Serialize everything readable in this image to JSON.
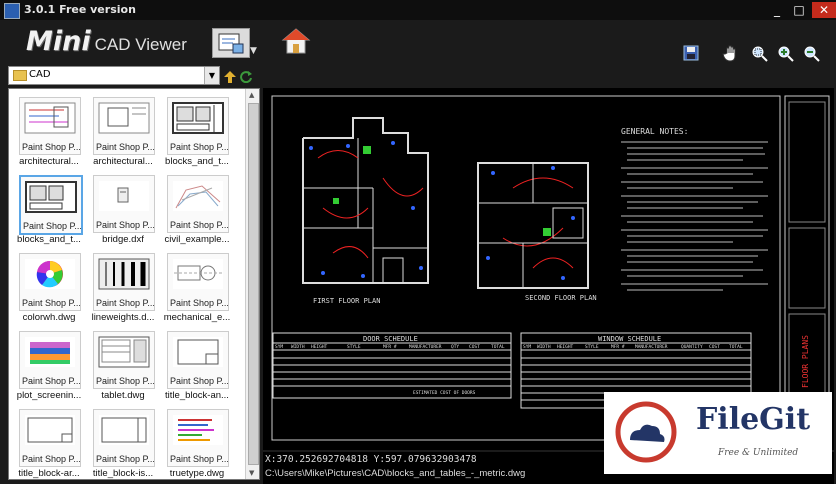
{
  "window": {
    "title": "3.0.1 Free version"
  },
  "toolbar": {
    "logo_main": "Mini",
    "logo_sub": "CAD Viewer"
  },
  "folder": {
    "name": "CAD"
  },
  "files": [
    {
      "name": "architectural...",
      "thumb_label": "Paint Shop P..."
    },
    {
      "name": "architectural...",
      "thumb_label": "Paint Shop P..."
    },
    {
      "name": "blocks_and_t...",
      "thumb_label": "Paint Shop P..."
    },
    {
      "name": "blocks_and_t...",
      "thumb_label": "Paint Shop P..."
    },
    {
      "name": "bridge.dxf",
      "thumb_label": "Paint Shop P..."
    },
    {
      "name": "civil_example...",
      "thumb_label": "Paint Shop P..."
    },
    {
      "name": "colorwh.dwg",
      "thumb_label": "Paint Shop P..."
    },
    {
      "name": "lineweights.d...",
      "thumb_label": "Paint Shop P..."
    },
    {
      "name": "mechanical_e...",
      "thumb_label": "Paint Shop P..."
    },
    {
      "name": "plot_screenin...",
      "thumb_label": "Paint Shop P..."
    },
    {
      "name": "tablet.dwg",
      "thumb_label": "Paint Shop P..."
    },
    {
      "name": "title_block-an...",
      "thumb_label": "Paint Shop P..."
    },
    {
      "name": "title_block-ar...",
      "thumb_label": "Paint Shop P..."
    },
    {
      "name": "title_block-is...",
      "thumb_label": "Paint Shop P..."
    },
    {
      "name": "truetype.dwg",
      "thumb_label": "Paint Shop P..."
    }
  ],
  "drawing": {
    "general_notes_title": "GENERAL NOTES:",
    "first_floor_label": "FIRST FLOOR PLAN",
    "second_floor_label": "SECOND FLOOR PLAN",
    "door_schedule_title": "DOOR SCHEDULE",
    "window_schedule_title": "WINDOW SCHEDULE",
    "door_headers": [
      "SYM",
      "WIDTH",
      "HEIGHT",
      "STYLE",
      "MFR #",
      "MANUFACTURER",
      "QTY",
      "COST",
      "TOTAL"
    ],
    "window_headers": [
      "SYM",
      "WIDTH",
      "HEIGHT",
      "STYLE",
      "MFR #",
      "MANUFACTURER",
      "QUANTITY",
      "COST",
      "TOTAL"
    ],
    "door_footer": "ESTIMATED COST OF DOORS",
    "floor_plans_label": "FLOOR PLANS"
  },
  "status": {
    "coords": "X:370.252692704818  Y:597.079632903478",
    "path": "C:\\Users\\Mike\\Pictures\\CAD\\blocks_and_tables_-_metric.dwg"
  },
  "watermark": {
    "brand": "FileGit",
    "tagline": "Free & Unlimited"
  }
}
